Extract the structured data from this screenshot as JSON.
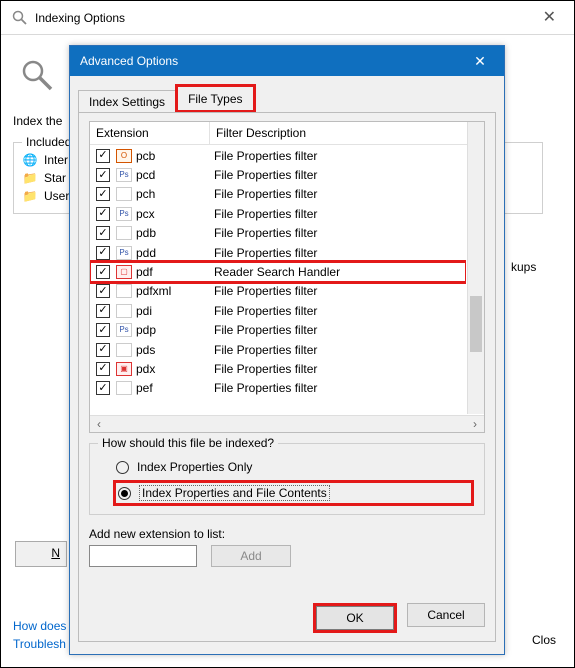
{
  "back_dialog": {
    "title": "Indexing Options",
    "index_these_label": "Index the",
    "included_legend": "Included",
    "items": [
      {
        "icon": "🌐",
        "label": "Inter"
      },
      {
        "icon": "📁",
        "label": "Star"
      },
      {
        "icon": "📁",
        "label": "User"
      }
    ],
    "right_frag": "kups",
    "links": [
      "How does",
      "Troublesh"
    ],
    "close_label": "Close",
    "modify_btn": "N"
  },
  "front_dialog": {
    "title": "Advanced Options",
    "tabs": [
      "Index Settings",
      "File Types"
    ],
    "active_tab": 1,
    "columns": {
      "ext": "Extension",
      "desc": "Filter Description"
    },
    "rows": [
      {
        "ext": "pcb",
        "icon": "off",
        "mark": "O",
        "desc": "File Properties filter"
      },
      {
        "ext": "pcd",
        "icon": "ps",
        "mark": "Ps",
        "desc": "File Properties filter"
      },
      {
        "ext": "pch",
        "icon": "",
        "mark": "",
        "desc": "File Properties filter"
      },
      {
        "ext": "pcx",
        "icon": "ps",
        "mark": "Ps",
        "desc": "File Properties filter"
      },
      {
        "ext": "pdb",
        "icon": "",
        "mark": "",
        "desc": "File Properties filter"
      },
      {
        "ext": "pdd",
        "icon": "ps",
        "mark": "Ps",
        "desc": "File Properties filter"
      },
      {
        "ext": "pdf",
        "icon": "pdf",
        "mark": "▢",
        "desc": "Reader Search Handler",
        "highlight": true
      },
      {
        "ext": "pdfxml",
        "icon": "",
        "mark": "",
        "desc": "File Properties filter"
      },
      {
        "ext": "pdi",
        "icon": "",
        "mark": "",
        "desc": "File Properties filter"
      },
      {
        "ext": "pdp",
        "icon": "ps",
        "mark": "Ps",
        "desc": "File Properties filter"
      },
      {
        "ext": "pds",
        "icon": "",
        "mark": "",
        "desc": "File Properties filter"
      },
      {
        "ext": "pdx",
        "icon": "pdf",
        "mark": "▣",
        "desc": "File Properties filter"
      },
      {
        "ext": "pef",
        "icon": "",
        "mark": "",
        "desc": "File Properties filter"
      }
    ],
    "group_legend": "How should this file be indexed?",
    "radios": [
      {
        "label": "Index Properties Only",
        "checked": false
      },
      {
        "label": "Index Properties and File Contents",
        "checked": true,
        "highlight": true
      }
    ],
    "add_label": "Add new extension to list:",
    "add_btn": "Add",
    "ok": "OK",
    "cancel": "Cancel"
  }
}
